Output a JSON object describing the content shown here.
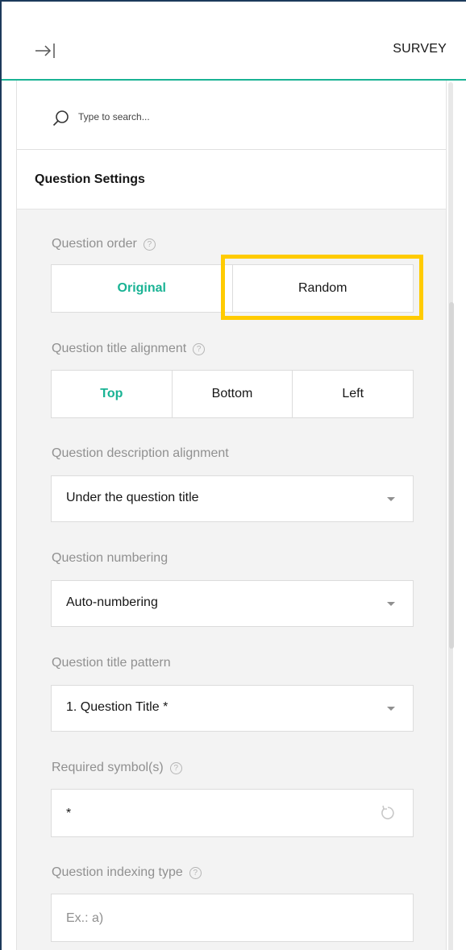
{
  "header": {
    "title": "SURVEY",
    "collapse_icon": "arrow-right-to-bar-icon"
  },
  "search": {
    "placeholder": "Type to search...",
    "icon": "search-icon"
  },
  "section": {
    "title": "Question Settings"
  },
  "fields": {
    "question_order": {
      "label": "Question order",
      "options": [
        "Original",
        "Random"
      ],
      "selected": "Original",
      "highlighted": "Random"
    },
    "title_alignment": {
      "label": "Question title alignment",
      "options": [
        "Top",
        "Bottom",
        "Left"
      ],
      "selected": "Top"
    },
    "description_alignment": {
      "label": "Question description alignment",
      "value": "Under the question title"
    },
    "numbering": {
      "label": "Question numbering",
      "value": "Auto-numbering"
    },
    "title_pattern": {
      "label": "Question title pattern",
      "value": "1. Question Title *"
    },
    "required_symbol": {
      "label": "Required symbol(s)",
      "value": "*"
    },
    "indexing_type": {
      "label": "Question indexing type",
      "placeholder": "Ex.: a)"
    }
  },
  "help_glyph": "?",
  "colors": {
    "accent": "#19b394",
    "highlight": "#ffcb00",
    "border_frame": "#1c3a5b"
  }
}
